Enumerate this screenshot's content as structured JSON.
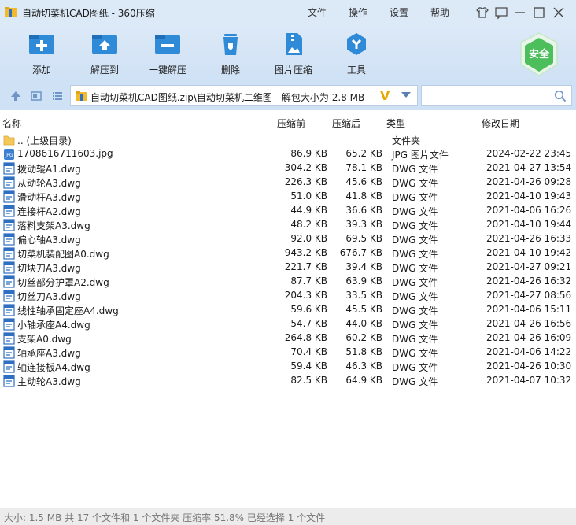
{
  "window": {
    "title": "自动切菜机CAD图纸 - 360压缩",
    "menu": [
      "文件",
      "操作",
      "设置",
      "帮助"
    ]
  },
  "toolbar": {
    "buttons": [
      "添加",
      "解压到",
      "一键解压",
      "删除",
      "图片压缩",
      "工具"
    ],
    "safety_badge": "安全"
  },
  "address": {
    "path": "自动切菜机CAD图纸.zip\\自动切菜机二维图 - 解包大小为 2.8 MB",
    "search_placeholder": ""
  },
  "columns": [
    "名称",
    "压缩前",
    "压缩后",
    "类型",
    "修改日期"
  ],
  "files": [
    {
      "name": ".. (上级目录)",
      "csize": "",
      "osize": "",
      "type": "文件夹",
      "date": "",
      "icon": "folder-icon"
    },
    {
      "name": "1708616711603.jpg",
      "csize": "86.9 KB",
      "osize": "65.2 KB",
      "type": "JPG 图片文件",
      "date": "2024-02-22 23:45",
      "icon": "jpg-file-icon"
    },
    {
      "name": "拨动辊A1.dwg",
      "csize": "304.2 KB",
      "osize": "78.1 KB",
      "type": "DWG 文件",
      "date": "2021-04-27 13:54",
      "icon": "dwg-file-icon"
    },
    {
      "name": "从动轮A3.dwg",
      "csize": "226.3 KB",
      "osize": "45.6 KB",
      "type": "DWG 文件",
      "date": "2021-04-26 09:28",
      "icon": "dwg-file-icon"
    },
    {
      "name": "滑动杆A3.dwg",
      "csize": "51.0 KB",
      "osize": "41.8 KB",
      "type": "DWG 文件",
      "date": "2021-04-10 19:43",
      "icon": "dwg-file-icon"
    },
    {
      "name": "连接杆A2.dwg",
      "csize": "44.9 KB",
      "osize": "36.6 KB",
      "type": "DWG 文件",
      "date": "2021-04-06 16:26",
      "icon": "dwg-file-icon"
    },
    {
      "name": "落料支架A3.dwg",
      "csize": "48.2 KB",
      "osize": "39.3 KB",
      "type": "DWG 文件",
      "date": "2021-04-10 19:44",
      "icon": "dwg-file-icon"
    },
    {
      "name": "偏心轴A3.dwg",
      "csize": "92.0 KB",
      "osize": "69.5 KB",
      "type": "DWG 文件",
      "date": "2021-04-26 16:33",
      "icon": "dwg-file-icon"
    },
    {
      "name": "切菜机装配图A0.dwg",
      "csize": "943.2 KB",
      "osize": "676.7 KB",
      "type": "DWG 文件",
      "date": "2021-04-10 19:42",
      "icon": "dwg-file-icon"
    },
    {
      "name": "切块刀A3.dwg",
      "csize": "221.7 KB",
      "osize": "39.4 KB",
      "type": "DWG 文件",
      "date": "2021-04-27 09:21",
      "icon": "dwg-file-icon"
    },
    {
      "name": "切丝部分护罩A2.dwg",
      "csize": "87.7 KB",
      "osize": "63.9 KB",
      "type": "DWG 文件",
      "date": "2021-04-26 16:32",
      "icon": "dwg-file-icon"
    },
    {
      "name": "切丝刀A3.dwg",
      "csize": "204.3 KB",
      "osize": "33.5 KB",
      "type": "DWG 文件",
      "date": "2021-04-27 08:56",
      "icon": "dwg-file-icon"
    },
    {
      "name": "线性轴承固定座A4.dwg",
      "csize": "59.6 KB",
      "osize": "45.5 KB",
      "type": "DWG 文件",
      "date": "2021-04-06 15:11",
      "icon": "dwg-file-icon"
    },
    {
      "name": "小轴承座A4.dwg",
      "csize": "54.7 KB",
      "osize": "44.0 KB",
      "type": "DWG 文件",
      "date": "2021-04-26 16:56",
      "icon": "dwg-file-icon"
    },
    {
      "name": "支架A0.dwg",
      "csize": "264.8 KB",
      "osize": "60.2 KB",
      "type": "DWG 文件",
      "date": "2021-04-26 16:09",
      "icon": "dwg-file-icon"
    },
    {
      "name": "轴承座A3.dwg",
      "csize": "70.4 KB",
      "osize": "51.8 KB",
      "type": "DWG 文件",
      "date": "2021-04-06 14:22",
      "icon": "dwg-file-icon"
    },
    {
      "name": "轴连接板A4.dwg",
      "csize": "59.4 KB",
      "osize": "46.3 KB",
      "type": "DWG 文件",
      "date": "2021-04-26 10:30",
      "icon": "dwg-file-icon"
    },
    {
      "name": "主动轮A3.dwg",
      "csize": "82.5 KB",
      "osize": "64.9 KB",
      "type": "DWG 文件",
      "date": "2021-04-07 10:32",
      "icon": "dwg-file-icon"
    }
  ],
  "status": "大小: 1.5 MB 共 17 个文件和 1 个文件夹 压缩率 51.8% 已经选择 1 个文件"
}
